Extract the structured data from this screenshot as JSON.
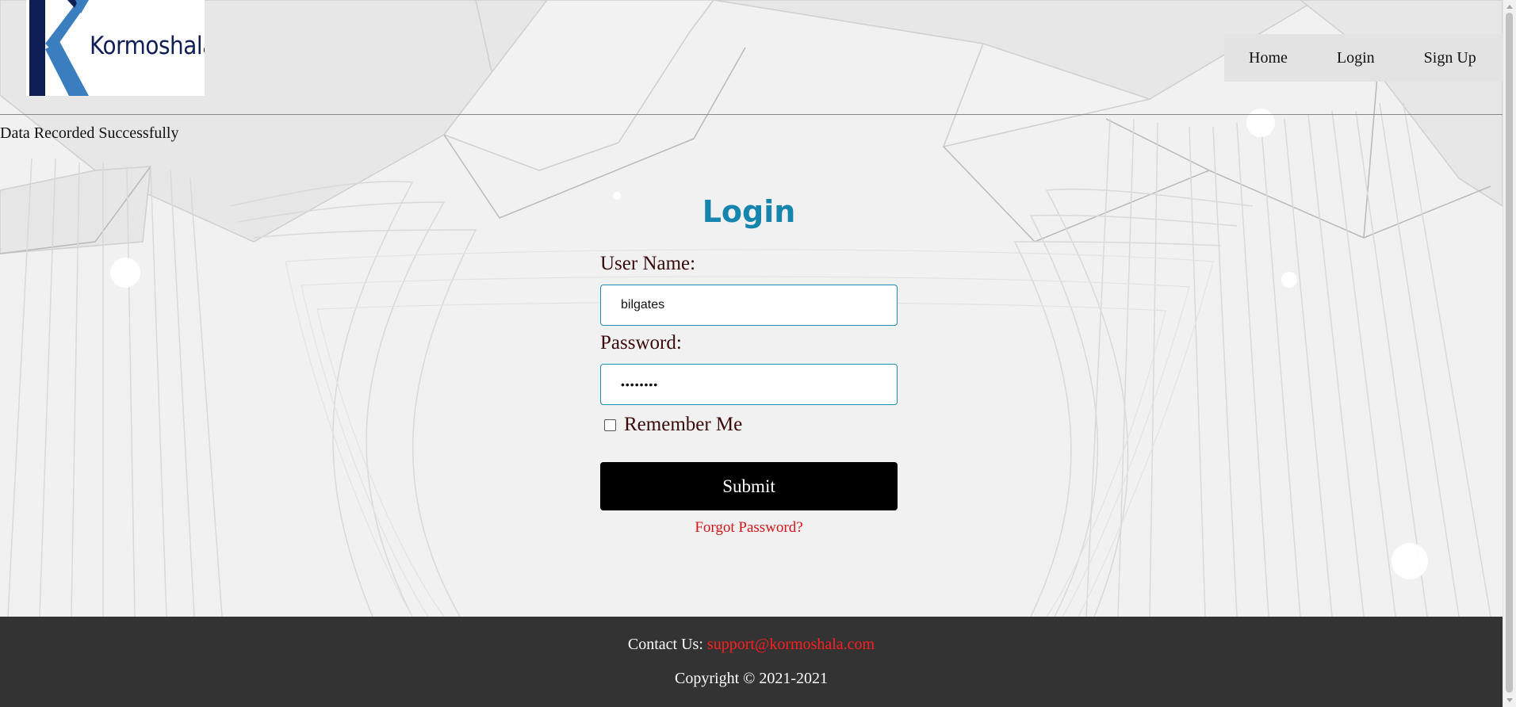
{
  "logo": {
    "text": "Kormoshala",
    "primary_color": "#0f1f55",
    "accent_color": "#3a7ebf"
  },
  "nav": {
    "items": [
      "Home",
      "Login",
      "Sign Up"
    ]
  },
  "flash_message": "Data Recorded Successfully",
  "form": {
    "title": "Login",
    "username_label": "User Name:",
    "username_value": "bilgates",
    "password_label": "Password:",
    "password_value": "••••••••",
    "remember_label": "Remember Me",
    "remember_checked": false,
    "submit_label": "Submit",
    "forgot_label": "Forgot Password?"
  },
  "footer": {
    "contact_label": "Contact Us:",
    "contact_email": "support@kormoshala.com",
    "copyright": "Copyright © 2021-2021"
  },
  "colors": {
    "title": "#1585ad",
    "input_border": "#1c8fb0",
    "link": "#d4141a",
    "footer_bg": "#333333",
    "button_bg": "#000000"
  }
}
